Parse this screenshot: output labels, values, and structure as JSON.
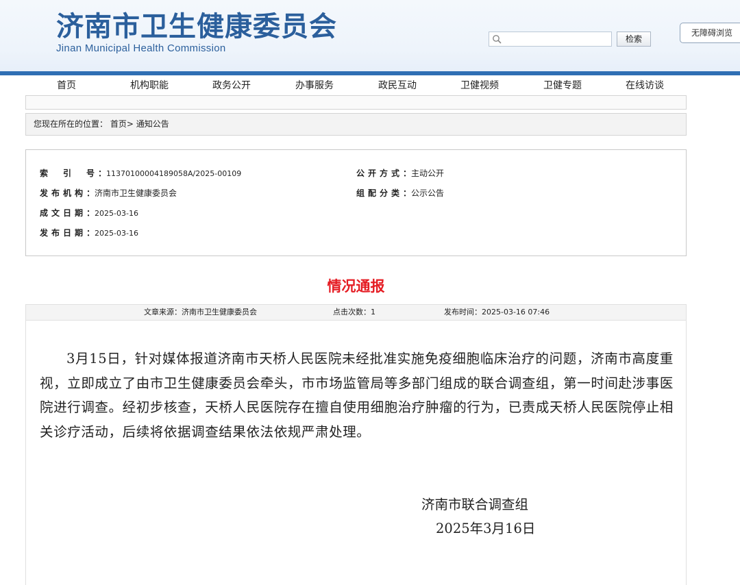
{
  "header": {
    "title_cn": "济南市卫生健康委员会",
    "title_en": "Jinan Municipal Health Commission",
    "search_value": "",
    "search_button": "检索",
    "accessibility_button": "无障碍浏览"
  },
  "nav": {
    "items": [
      "首页",
      "机构职能",
      "政务公开",
      "办事服务",
      "政民互动",
      "卫健视频",
      "卫健专题",
      "在线访谈"
    ]
  },
  "breadcrumb": {
    "prefix": "您现在所在的位置：",
    "home": "首页",
    "separator": ">",
    "current": "通知公告"
  },
  "meta": {
    "index_label": "索　引　号",
    "index_value": "11370100004189058A/2025-00109",
    "publisher_label": "发布机构",
    "publisher_value": "济南市卫生健康委员会",
    "created_label": "成文日期",
    "created_value": "2025-03-16",
    "published_label": "发布日期",
    "published_value": "2025-03-16",
    "mode_label": "公开方式",
    "mode_value": "主动公开",
    "category_label": "组配分类",
    "category_value": "公示公告",
    "colon": "："
  },
  "article": {
    "title": "情况通报",
    "source_label": "文章来源：",
    "source_value": "济南市卫生健康委员会",
    "clicks_label": "点击次数：",
    "clicks_value": "1",
    "time_label": "发布时间：",
    "time_value": "2025-03-16 07:46",
    "body": "3月15日，针对媒体报道济南市天桥人民医院未经批准实施免疫细胞临床治疗的问题，济南市高度重视，立即成立了由市卫生健康委员会牵头，市市场监管局等多部门组成的联合调查组，第一时间赴涉事医院进行调查。经初步核查，天桥人民医院存在擅自使用细胞治疗肿瘤的行为，已责成天桥人民医院停止相关诊疗活动，后续将依据调查结果依法依规严肃处理。",
    "signature": "济南市联合调查组",
    "sign_date": "2025年3月16日"
  }
}
